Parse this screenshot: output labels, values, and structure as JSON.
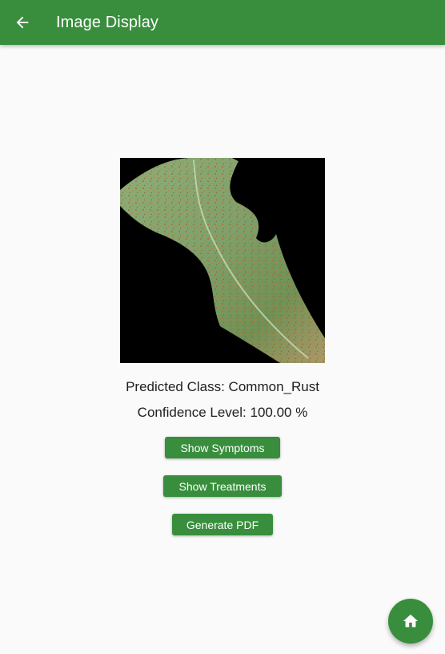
{
  "appbar": {
    "title": "Image Display",
    "back_icon": "arrow-back-icon",
    "color": "#388e3c"
  },
  "result": {
    "predicted_class": "Predicted Class: Common_Rust",
    "confidence": "Confidence Level: 100.00 %"
  },
  "actions": {
    "show_symptoms": "Show Symptoms",
    "show_treatments": "Show Treatments",
    "generate_pdf": "Generate PDF"
  },
  "fab": {
    "icon": "home-icon"
  }
}
